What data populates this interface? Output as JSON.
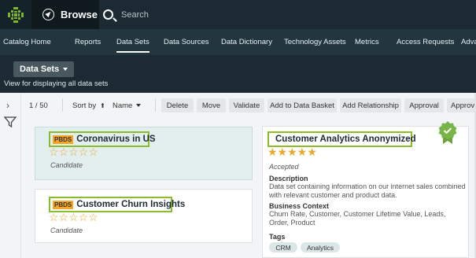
{
  "top": {
    "browse_label": "Browse",
    "search_placeholder": "Search"
  },
  "nav": {
    "items": [
      "Catalog Home",
      "Reports",
      "Data Sets",
      "Data Sources",
      "Data Dictionary",
      "Technology Assets",
      "Metrics",
      "Access Requests",
      "Adva"
    ],
    "active": "Data Sets"
  },
  "page": {
    "title": "Data Sets",
    "subtitle": "View for displaying all data sets"
  },
  "toolbar": {
    "count": "1 / 50",
    "sort_by": "Sort by",
    "sort_arrow": "⬆",
    "sort_field": "Name",
    "buttons": [
      "Delete",
      "Move",
      "Validate",
      "Add to Data Basket",
      "Add Relationship",
      "Approval",
      "Approval"
    ]
  },
  "cards": [
    {
      "badge": "PBDS",
      "name": "Coronavirus in US",
      "stars": "☆☆☆☆☆",
      "state": "Candidate"
    },
    {
      "badge": "PBDS",
      "name": "Customer Churn Insights",
      "stars": "☆☆☆☆☆",
      "state": "Candidate"
    }
  ],
  "detail": {
    "name": "Customer Analytics Anonymized",
    "stars": "★★★★★",
    "state": "Accepted",
    "description_label": "Description",
    "description": "Data set containing information on our internet sales combined with relevant customer and product data.",
    "context_label": "Business Context",
    "context": "Churn Rate, Customer, Customer Lifetime Value, Leads, Order, Product",
    "tags_label": "Tags",
    "tags": [
      "CRM",
      "Analytics"
    ]
  },
  "colors": {
    "accent": "#8cbc2c",
    "header": "#1c2b33",
    "nav": "#233640",
    "star": "#e9a82a",
    "badge": "#f5a623"
  }
}
